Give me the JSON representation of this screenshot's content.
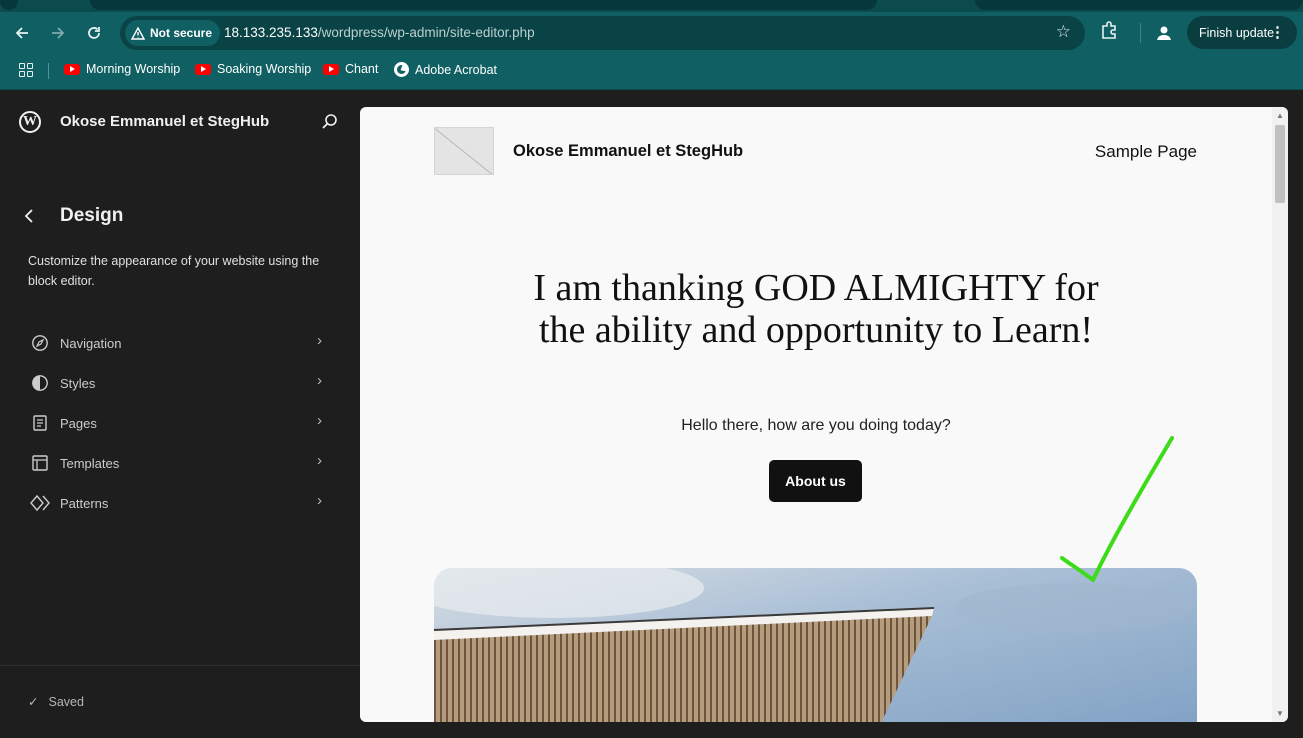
{
  "browser": {
    "security_label": "Not secure",
    "url_host": "18.133.235.133",
    "url_path": "/wordpress/wp-admin/site-editor.php",
    "finish_update_label": "Finish update",
    "bookmarks": [
      {
        "label": "Morning Worship",
        "icon": "youtube-icon"
      },
      {
        "label": "Soaking Worship",
        "icon": "youtube-icon"
      },
      {
        "label": "Chant",
        "icon": "youtube-icon"
      },
      {
        "label": "Adobe Acrobat",
        "icon": "globe-icon"
      }
    ]
  },
  "sidebar": {
    "site_title": "Okose Emmanuel et StegHub",
    "section_title": "Design",
    "description": "Customize the appearance of your website using the block editor.",
    "items": [
      {
        "label": "Navigation",
        "icon": "navigation-icon"
      },
      {
        "label": "Styles",
        "icon": "styles-icon"
      },
      {
        "label": "Pages",
        "icon": "pages-icon"
      },
      {
        "label": "Templates",
        "icon": "templates-icon"
      },
      {
        "label": "Patterns",
        "icon": "patterns-icon"
      }
    ],
    "status": "Saved"
  },
  "canvas": {
    "site_title": "Okose Emmanuel et StegHub",
    "nav_link": "Sample Page",
    "heading": "I am thanking GOD ALMIGHTY for the ability and opportunity to Learn!",
    "subheading": "Hello there, how are you doing today?",
    "button_label": "About us"
  },
  "colors": {
    "browser_chrome": "#0f5f63",
    "sidebar_bg": "#1e1e1e",
    "canvas_bg": "#f9f9f9",
    "annotation_check": "#3ddc1a"
  }
}
